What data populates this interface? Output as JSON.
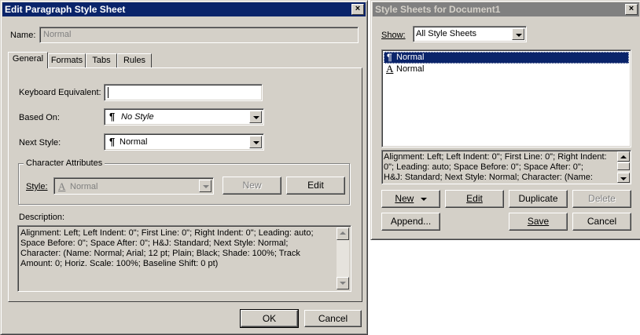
{
  "left_dialog": {
    "title": "Edit Paragraph Style Sheet",
    "close": "×",
    "name_label": "Name:",
    "name_value": "Normal",
    "tabs": [
      {
        "label": "General"
      },
      {
        "label": "Formats"
      },
      {
        "label": "Tabs"
      },
      {
        "label": "Rules"
      }
    ],
    "keyboard_label": "Keyboard Equivalent:",
    "keyboard_value": "",
    "based_on_label": "Based On:",
    "based_on_value": "No Style",
    "next_style_label": "Next Style:",
    "next_style_value": "Normal",
    "char_attr_legend": "Character Attributes",
    "style_label": "Style:",
    "style_value": "Normal",
    "new_button": "New",
    "edit_button": "Edit",
    "description_label": "Description:",
    "description_text": "Alignment: Left;  Left Indent: 0\";  First Line: 0\";  Right Indent: 0\";  Leading: auto;\nSpace Before: 0\";  Space After: 0\";  H&J: Standard;  Next Style: Normal;\nCharacter: (Name: Normal;  Arial;  12 pt;  Plain;  Black;  Shade: 100%;  Track\nAmount: 0;  Horiz. Scale: 100%;  Baseline Shift: 0 pt)",
    "ok_button": "OK",
    "cancel_button": "Cancel"
  },
  "right_dialog": {
    "title": "Style Sheets for Document1",
    "close": "×",
    "show_label": "Show:",
    "show_value": "All Style Sheets",
    "styles": [
      {
        "icon": "¶",
        "label": "Normal",
        "selected": true
      },
      {
        "icon": "A",
        "label": "Normal",
        "selected": false
      }
    ],
    "description_text": "Alignment: Left;  Left Indent: 0\";  First Line: 0\";  Right Indent:\n0\";  Leading: auto;  Space Before: 0\";  Space After: 0\";\nH&J: Standard;  Next Style: Normal;  Character: (Name:",
    "new_button": "New",
    "edit_button": "Edit",
    "duplicate_button": "Duplicate",
    "delete_button": "Delete",
    "append_button": "Append...",
    "save_button": "Save",
    "cancel_button": "Cancel"
  },
  "colors": {
    "titlebar_active": "#0a246a",
    "titlebar_inactive": "#808080",
    "face": "#d4d0c8",
    "selection": "#0a246a"
  }
}
